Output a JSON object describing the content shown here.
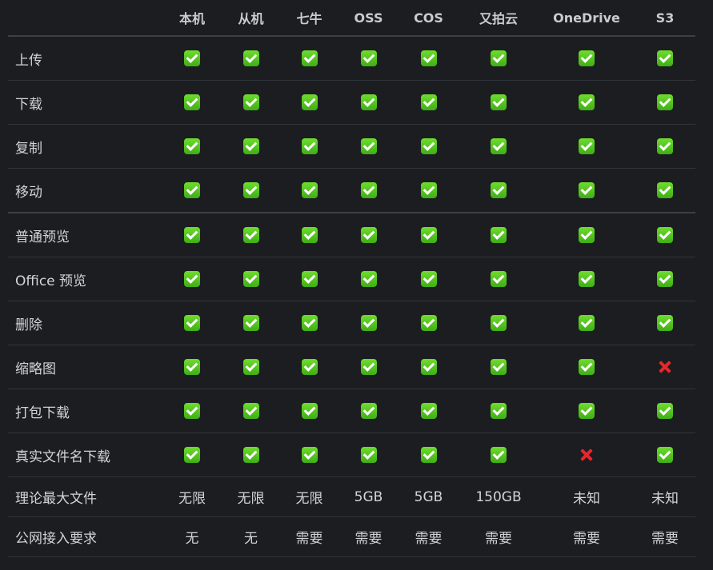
{
  "columns": [
    "本机",
    "从机",
    "七牛",
    "OSS",
    "COS",
    "又拍云",
    "OneDrive",
    "S3"
  ],
  "rows": [
    {
      "feature": "上传",
      "cells": [
        "check",
        "check",
        "check",
        "check",
        "check",
        "check",
        "check",
        "check"
      ]
    },
    {
      "feature": "下载",
      "cells": [
        "check",
        "check",
        "check",
        "check",
        "check",
        "check",
        "check",
        "check"
      ]
    },
    {
      "feature": "复制",
      "cells": [
        "check",
        "check",
        "check",
        "check",
        "check",
        "check",
        "check",
        "check"
      ]
    },
    {
      "feature": "移动",
      "cells": [
        "check",
        "check",
        "check",
        "check",
        "check",
        "check",
        "check",
        "check"
      ]
    },
    {
      "feature": "普通预览",
      "cells": [
        "check",
        "check",
        "check",
        "check",
        "check",
        "check",
        "check",
        "check"
      ]
    },
    {
      "feature": "Office 预览",
      "cells": [
        "check",
        "check",
        "check",
        "check",
        "check",
        "check",
        "check",
        "check"
      ]
    },
    {
      "feature": "删除",
      "cells": [
        "check",
        "check",
        "check",
        "check",
        "check",
        "check",
        "check",
        "check"
      ]
    },
    {
      "feature": "缩略图",
      "cells": [
        "check",
        "check",
        "check",
        "check",
        "check",
        "check",
        "check",
        "cross"
      ]
    },
    {
      "feature": "打包下载",
      "cells": [
        "check",
        "check",
        "check",
        "check",
        "check",
        "check",
        "check",
        "check"
      ]
    },
    {
      "feature": "真实文件名下载",
      "cells": [
        "check",
        "check",
        "check",
        "check",
        "check",
        "check",
        "cross",
        "check"
      ]
    },
    {
      "feature": "理论最大文件",
      "cells": [
        "无限",
        "无限",
        "无限",
        "5GB",
        "5GB",
        "150GB",
        "未知",
        "未知"
      ]
    },
    {
      "feature": "公网接入要求",
      "cells": [
        "无",
        "无",
        "需要",
        "需要",
        "需要",
        "需要",
        "需要",
        "需要"
      ]
    }
  ],
  "icons": {
    "check": "green-checkmark-icon",
    "cross": "red-cross-icon"
  },
  "colors": {
    "background": "#1b1d20",
    "check": "#4cc21e",
    "cross": "#e8262b",
    "text": "#d2d5d8"
  }
}
